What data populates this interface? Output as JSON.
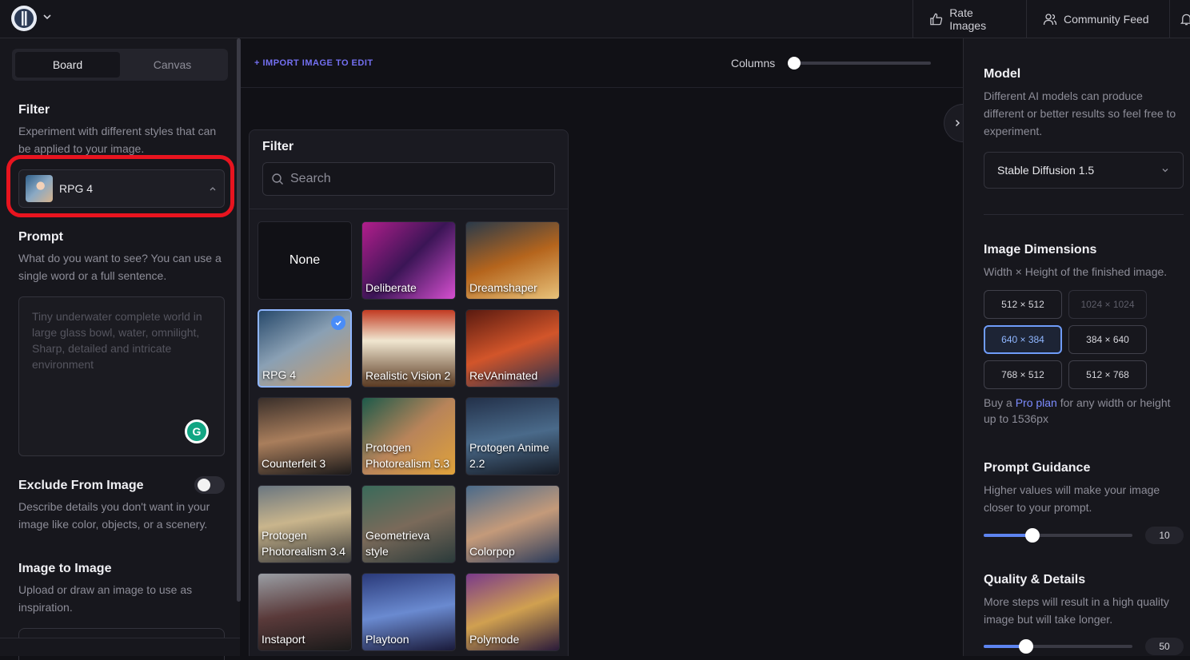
{
  "topbar": {
    "rate_label": "Rate Images",
    "community_label": "Community Feed"
  },
  "left": {
    "tabs": [
      {
        "label": "Board",
        "active": true
      },
      {
        "label": "Canvas",
        "active": false
      }
    ],
    "filter": {
      "title": "Filter",
      "desc": "Experiment with different styles that can be applied to your image.",
      "selected": "RPG 4"
    },
    "prompt": {
      "title": "Prompt",
      "desc": "What do you want to see? You can use a single word or a full sentence.",
      "placeholder": "Tiny underwater complete world in large glass bowl, water, omnilight, Sharp, detailed and intricate environment"
    },
    "exclude": {
      "title": "Exclude From Image",
      "desc": "Describe details you don't want in your image like color, objects, or a scenery.",
      "enabled": false
    },
    "img2img": {
      "title": "Image to Image",
      "desc": "Upload or draw an image to use as inspiration."
    }
  },
  "center": {
    "import_label": "+ IMPORT IMAGE TO EDIT",
    "columns_label": "Columns",
    "filter_panel": {
      "title": "Filter",
      "search_placeholder": "Search",
      "items": [
        {
          "label": "None",
          "bg": "#111116",
          "selected": false
        },
        {
          "label": "Deliberate",
          "bg": "linear-gradient(135deg,#b21e8c,#3b1556 50%,#d64fd0)",
          "selected": false
        },
        {
          "label": "Dreamshaper",
          "bg": "linear-gradient(160deg,#2a3a4a,#b5651d 50%,#e8c27a)",
          "selected": false
        },
        {
          "label": "RPG 4",
          "bg": "linear-gradient(150deg,#27496b,#8aa0b4 45%,#c79b6a)",
          "selected": true
        },
        {
          "label": "Realistic Vision 2",
          "bg": "linear-gradient(180deg,#c23b22,#f0e6d0 40%,#5a3a22)",
          "selected": false
        },
        {
          "label": "ReVAnimated",
          "bg": "linear-gradient(160deg,#5a1a10,#d2552a 50%,#23304f)",
          "selected": false
        },
        {
          "label": "Counterfeit 3",
          "bg": "linear-gradient(170deg,#3a2f2a,#a97e5c 50%,#1c1a1a)",
          "selected": false
        },
        {
          "label": "Protogen Photorealism 5.3",
          "bg": "linear-gradient(140deg,#1d5a4a,#b8845a 50%,#e0a23a)",
          "selected": false
        },
        {
          "label": "Protogen Anime 2.2",
          "bg": "linear-gradient(170deg,#23314a,#4a6a8a 50%,#151a24)",
          "selected": false
        },
        {
          "label": "Protogen Photorealism 3.4",
          "bg": "linear-gradient(170deg,#6a7680,#c9b58c 45%,#3b3b3b)",
          "selected": false
        },
        {
          "label": "Geometrieva style",
          "bg": "linear-gradient(160deg,#3a6a5a,#7a6a5a 50%,#2a3a3a)",
          "selected": false
        },
        {
          "label": "Colorpop",
          "bg": "linear-gradient(160deg,#4a6a8a,#c49a7a 50%,#2a3a5a)",
          "selected": false
        },
        {
          "label": "Instaport",
          "bg": "linear-gradient(170deg,#9a9ea4,#5a3a3a 50%,#1a1a1a)",
          "selected": false
        },
        {
          "label": "Playtoon",
          "bg": "linear-gradient(170deg,#2a3a7a,#6a8ad0 50%,#1a1a3a)",
          "selected": false
        },
        {
          "label": "Polymode",
          "bg": "linear-gradient(160deg,#7a3a8a,#d0a050 50%,#2a1a3a)",
          "selected": false
        }
      ]
    }
  },
  "right": {
    "model": {
      "title": "Model",
      "desc": "Different AI models can produce different or better results so feel free to experiment.",
      "selected": "Stable Diffusion 1.5"
    },
    "dimensions": {
      "title": "Image Dimensions",
      "desc": "Width × Height of the finished image.",
      "options": [
        {
          "label": "512 × 512",
          "state": "normal"
        },
        {
          "label": "1024 × 1024",
          "state": "disabled"
        },
        {
          "label": "640 × 384",
          "state": "active"
        },
        {
          "label": "384 × 640",
          "state": "normal"
        },
        {
          "label": "768 × 512",
          "state": "normal"
        },
        {
          "label": "512 × 768",
          "state": "normal"
        }
      ],
      "pro_prefix": "Buy a ",
      "pro_link": "Pro plan",
      "pro_suffix": " for any width or height up to 1536px"
    },
    "guidance": {
      "title": "Prompt Guidance",
      "desc": "Higher values will make your image closer to your prompt.",
      "value": "10",
      "fraction": 0.33
    },
    "quality": {
      "title": "Quality & Details",
      "desc": "More steps will result in a high quality image but will take longer.",
      "value": "50",
      "fraction": 0.285
    }
  }
}
